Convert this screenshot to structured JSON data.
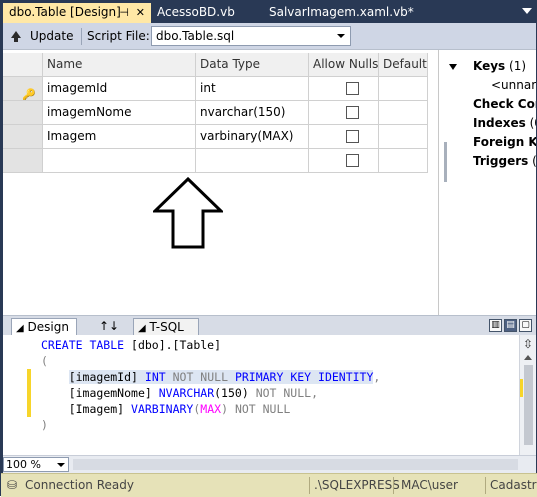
{
  "tabs": {
    "active": "dbo.Table [Design]",
    "second": "AcessoBD.vb",
    "third": "SalvarImagem.xaml.vb*"
  },
  "toolbar": {
    "update_label": "Update",
    "script_file_label": "Script File:",
    "script_file_value": "dbo.Table.sql"
  },
  "grid": {
    "headers": {
      "name": "Name",
      "data_type": "Data Type",
      "allow_nulls": "Allow Nulls",
      "default": "Default"
    },
    "rows": [
      {
        "name": "imagemId",
        "data_type": "int",
        "allow_nulls": false,
        "is_key": true
      },
      {
        "name": "imagemNome",
        "data_type": "nvarchar(150)",
        "allow_nulls": false,
        "is_key": false
      },
      {
        "name": "Imagem",
        "data_type": "varbinary(MAX)",
        "allow_nulls": false,
        "is_key": false
      },
      {
        "name": "",
        "data_type": "",
        "allow_nulls": false,
        "is_key": false
      }
    ]
  },
  "properties": {
    "keys_label": "Keys",
    "keys_count": "(1)",
    "key_item": "<unnar",
    "check_constraints": "Check Cor",
    "indexes": "Indexes",
    "indexes_count": "(0",
    "foreign_keys": "Foreign Ke",
    "triggers": "Triggers",
    "triggers_count": "("
  },
  "panes": {
    "design_label": "Design",
    "swap_label": "↑↓",
    "tsql_label": "T-SQL"
  },
  "sql": {
    "line1_kw": "CREATE TABLE",
    "line1_rest": " [dbo].[Table]",
    "line2": "(",
    "line3_col": "[imagemId]",
    "line3_type": "INT",
    "line3_notnull": "NOT NULL",
    "line3_pk": "PRIMARY KEY IDENTITY",
    "line3_end": ",",
    "line4_col": "[imagemNome]",
    "line4_type": "NVARCHAR",
    "line4_len": "(150)",
    "line4_notnull": "NOT NULL",
    "line4_end": ",",
    "line5_col": "[Imagem]",
    "line5_type": "VARBINARY",
    "line5_open": "(",
    "line5_max": "MAX",
    "line5_close": ")",
    "line5_notnull": "NOT NULL",
    "line6": ")"
  },
  "zoom": {
    "value": "100 %"
  },
  "status": {
    "connection": "Connection Ready",
    "server": ".\\SQLEXPRESS",
    "user": "MAC\\user",
    "database": "Cadastro"
  },
  "colors": {
    "active_tab": "#ffe8a6",
    "chrome": "#293955",
    "keyword": "#0000ff",
    "gray_keyword": "#808080",
    "function": "#ff00ff",
    "status_bar": "#e6e2b8"
  }
}
